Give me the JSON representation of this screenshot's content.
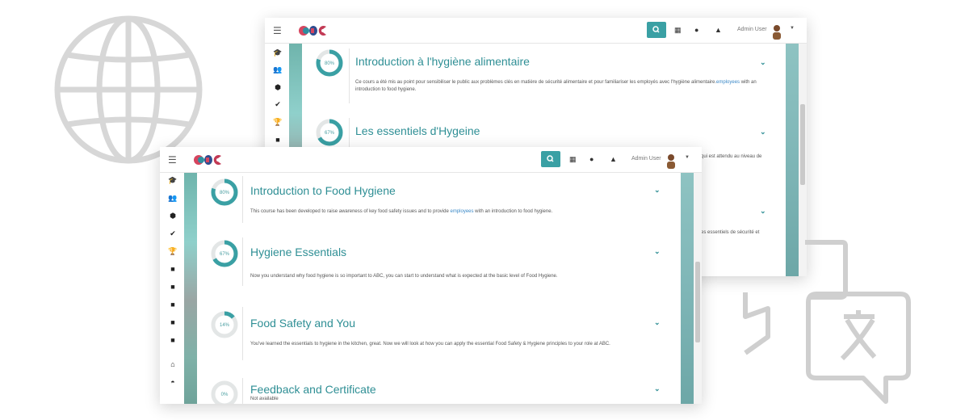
{
  "front": {
    "admin": "Admin User",
    "courses": [
      {
        "progress": 80,
        "label": "80%",
        "title": "Introduction to Food Hygiene",
        "desc_before": "This course has been developed to raise awareness of key food safety issues and to provide ",
        "desc_link": "employees",
        "desc_after": " with an introduction to food hygiene."
      },
      {
        "progress": 67,
        "label": "67%",
        "title": "Hygiene Essentials",
        "desc_before": "Now you understand why food hygiene is so important to ABC, you can start to understand what is expected at the basic level of Food Hygiene.",
        "desc_link": "",
        "desc_after": ""
      },
      {
        "progress": 14,
        "label": "14%",
        "title": "Food Safety and You",
        "desc_before": "You've learned the essentials to hygiene in the kitchen, great. Now we will look at how you can apply the essential Food Safety & Hygiene principles to your role at ABC.",
        "desc_link": "",
        "desc_after": ""
      },
      {
        "progress": 0,
        "label": "0%",
        "title": "Feedback and Certificate",
        "desc_before": "Not available",
        "desc_link": "",
        "desc_after": ""
      }
    ]
  },
  "back": {
    "admin": "Admin User",
    "courses": [
      {
        "progress": 80,
        "label": "80%",
        "title": "Introduction à l'hygiène alimentaire",
        "desc_before": "Ce cours a été mis au point pour sensibiliser le public aux problèmes clés en matière de sécurité alimentaire et pour familiariser les employés avec l'hygiène alimentaire.",
        "desc_link": "employees",
        "desc_after": " with an introduction to food hygiene."
      },
      {
        "progress": 67,
        "label": "67%",
        "title": "Les essentiels d'Hygeine",
        "desc_before": "",
        "desc_link": "",
        "desc_after": ""
      }
    ],
    "peek_texts": [
      "qui est attendu au niveau de",
      "es essentiels de sécurité et"
    ]
  },
  "colors": {
    "accent": "#3aa0a4",
    "title": "#2f8f95",
    "ring_track": "#e3e6e6",
    "link": "#3a88c7"
  }
}
